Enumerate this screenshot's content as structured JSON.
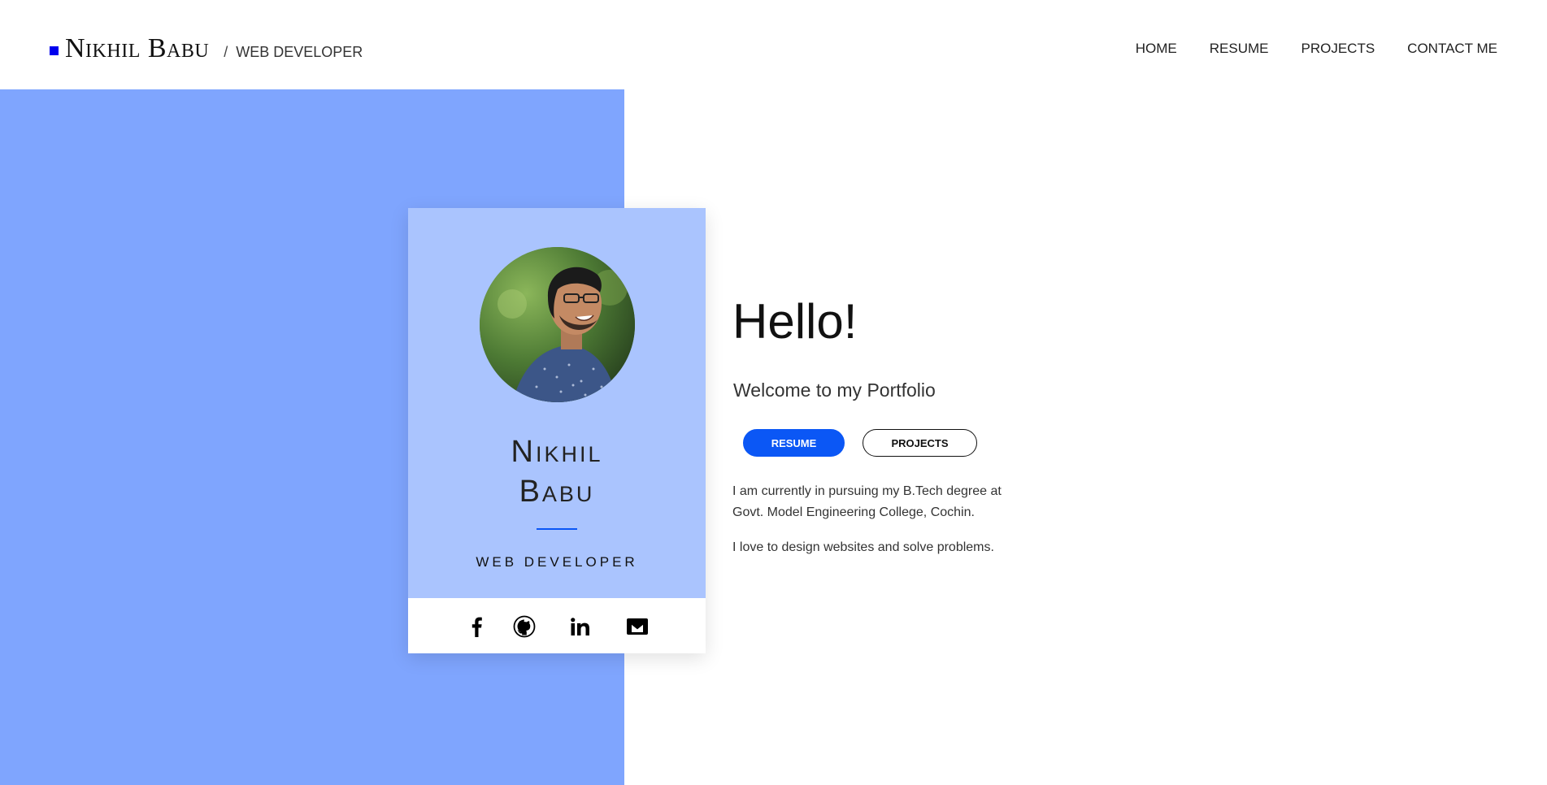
{
  "header": {
    "brand_name": "Nikhil Babu",
    "separator": "/",
    "brand_role": "WEB DEVELOPER",
    "nav": [
      "HOME",
      "RESUME",
      "PROJECTS",
      "CONTACT ME"
    ]
  },
  "card": {
    "name_line1": "Nikhil",
    "name_line2": "Babu",
    "role": "WEB DEVELOPER",
    "social": [
      "facebook-icon",
      "github-icon",
      "linkedin-icon",
      "gmail-icon"
    ]
  },
  "main": {
    "greeting": "Hello!",
    "welcome": "Welcome to my Portfolio",
    "resume_button": "RESUME",
    "projects_button": "PROJECTS",
    "bio_1": "I am currently in pursuing my B.Tech degree at Govt. Model Engineering College, Cochin.",
    "bio_2": "I love to design websites and solve problems."
  },
  "colors": {
    "accent": "#0b57f5",
    "panel_blue": "#7fa5fe",
    "card_blue": "#aac4fe",
    "brand_square": "#0000ee"
  }
}
